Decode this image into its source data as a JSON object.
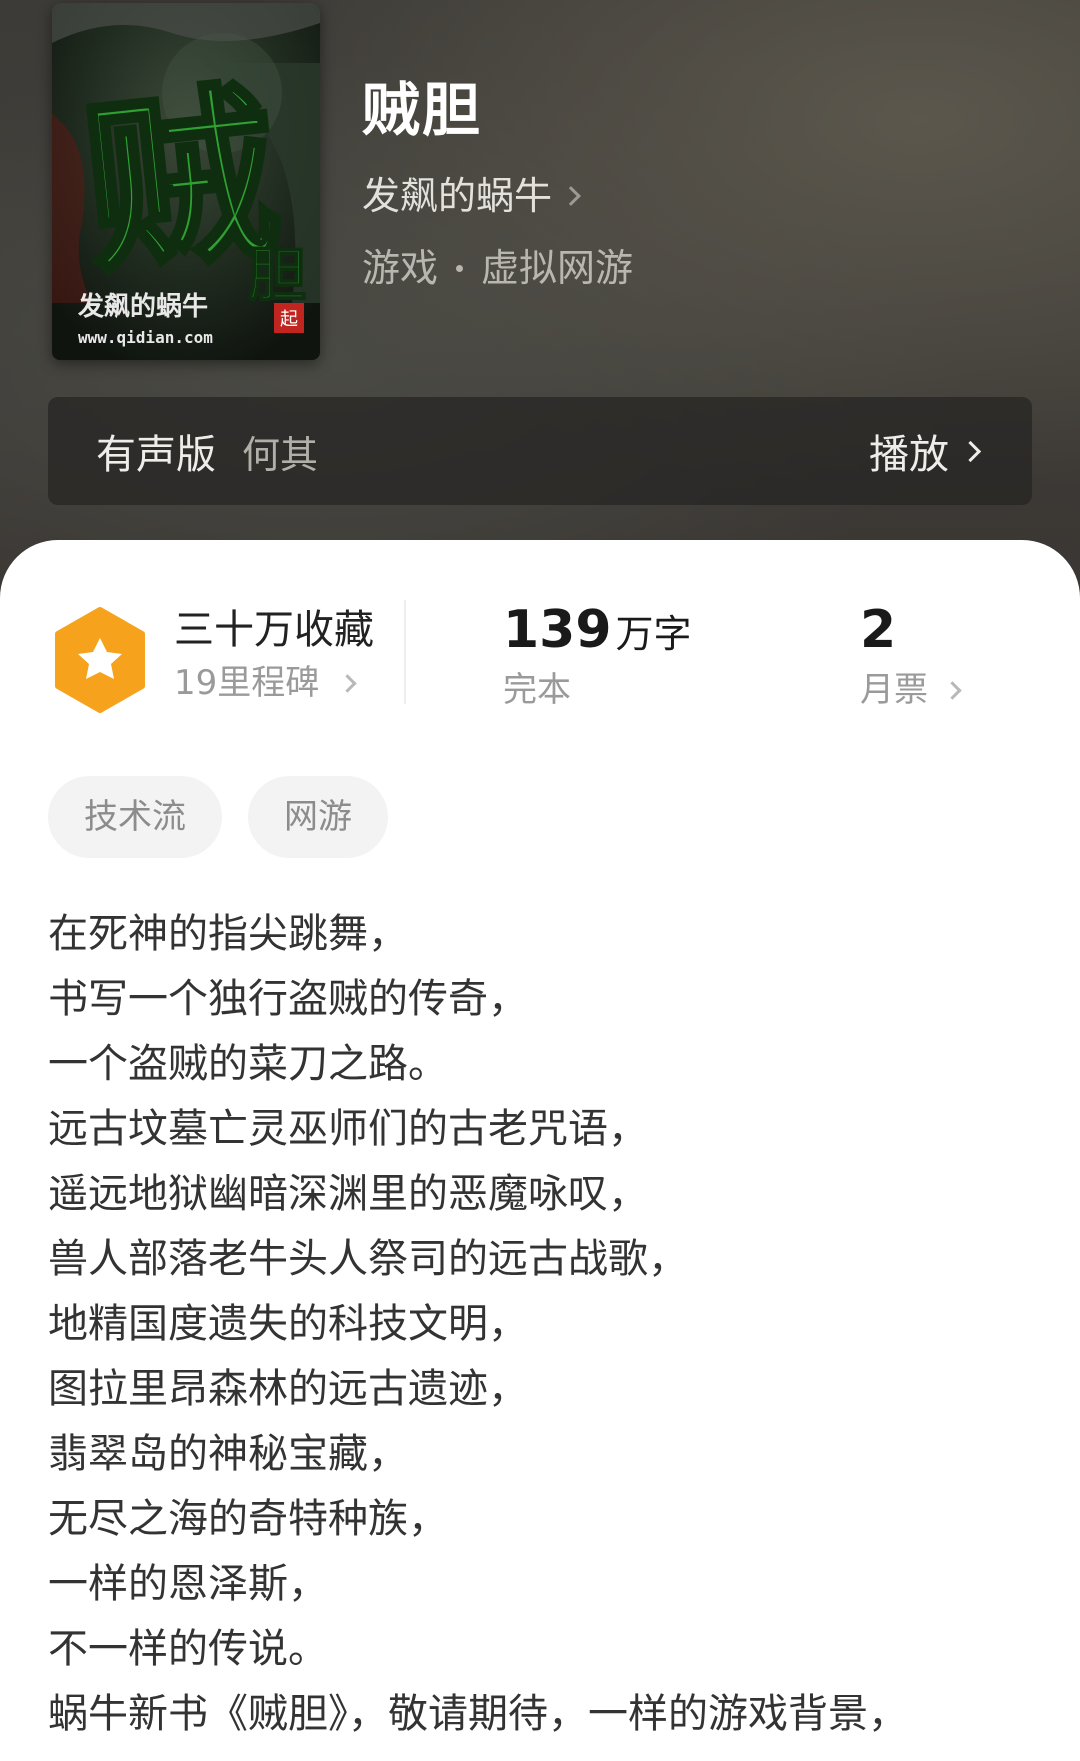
{
  "book": {
    "title": "贼胆",
    "author": "发飙的蜗牛",
    "genre_primary": "游戏",
    "genre_secondary": "虚拟网游",
    "cover": {
      "big_char": "贼",
      "small_char": "胆",
      "author_text": "发飙的蜗牛",
      "url_text": "www.qidian.com",
      "seal_text": "起"
    }
  },
  "audio": {
    "label": "有声版",
    "narrator": "何其",
    "play_label": "播放"
  },
  "stats": {
    "collect_label": "三十万收藏",
    "milestone_label": "19里程碑",
    "word_count": "139",
    "word_unit": "万字",
    "status": "完本",
    "monthly_votes": "2",
    "monthly_votes_label": "月票"
  },
  "tags": [
    "技术流",
    "网游"
  ],
  "intro_lines": [
    "在死神的指尖跳舞，",
    "书写一个独行盗贼的传奇，",
    "一个盗贼的菜刀之路。",
    "远古坟墓亡灵巫师们的古老咒语，",
    "遥远地狱幽暗深渊里的恶魔咏叹，",
    "兽人部落老牛头人祭司的远古战歌，",
    "地精国度遗失的科技文明，",
    "图拉里昂森林的远古遗迹，",
    "翡翠岛的神秘宝藏，",
    "无尽之海的奇特种族，",
    "一样的恩泽斯，",
    "不一样的传说。",
    "蜗牛新书《贼胆》，敬请期待，一样的游戏背景，"
  ],
  "colors": {
    "header_bg": "#3d3b37",
    "badge_orange": "#f6a21c",
    "cover_green": "#2fa032"
  }
}
